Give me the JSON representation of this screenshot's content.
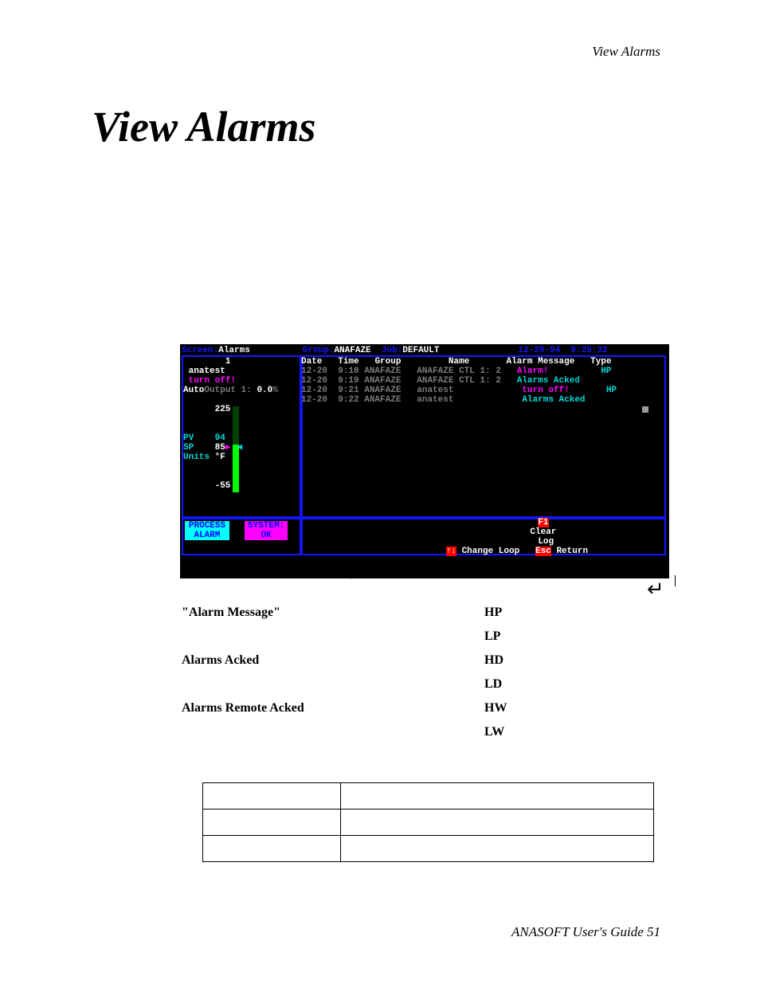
{
  "doc": {
    "running_head": "View Alarms",
    "title": "View Alarms",
    "footer": "ANASOFT User's Guide  51"
  },
  "arrows": {
    "down": "↓",
    "left": "↵"
  },
  "term": {
    "header": {
      "screen_label": "Screen:",
      "screen_val": "Alarms",
      "group_label": "Group:",
      "group_val": "ANAFAZE",
      "job_label": "Job:",
      "job_val": "DEFAULT",
      "date": "12-20-94",
      "time": "9:25:32"
    },
    "left_panel": {
      "index": "1",
      "name": "anatest",
      "warn": "turn off!",
      "auto_label": "Auto",
      "output_label": "Output 1:",
      "output_val": "0.0",
      "output_unit": "%",
      "hi": "225",
      "pv_label": "PV",
      "pv_val": "94",
      "sp_label": "SP",
      "sp_val": "85",
      "units_label": "Units",
      "units_val": "°F",
      "lo": "-55"
    },
    "right_panel": {
      "cols": {
        "c1": "Date",
        "c2": "Time",
        "c3": "Group",
        "c4": "Name",
        "c5": "Alarm Message",
        "c6": "Type"
      },
      "rows": [
        {
          "date": "12-20",
          "time": "9:18",
          "group": "ANAFAZE",
          "name": "ANAFAZE CTL 1: 2",
          "msg": "Alarm!",
          "type": "HP"
        },
        {
          "date": "12-20",
          "time": "9:19",
          "group": "ANAFAZE",
          "name": "ANAFAZE CTL 1: 2",
          "msg": "Alarms Acked",
          "type": ""
        },
        {
          "date": "12-20",
          "time": "9:21",
          "group": "ANAFAZE",
          "name": "anatest",
          "msg": "turn off!",
          "type": "HP"
        },
        {
          "date": "12-20",
          "time": "9:22",
          "group": "ANAFAZE",
          "name": "anatest",
          "msg": "Alarms Acked",
          "type": ""
        }
      ]
    },
    "status": {
      "process_l1": "PROCESS",
      "process_l2": "ALARM",
      "system_l1": "SYSTEM:",
      "system_l2": "OK",
      "f1_key": "F1",
      "f1_l1": "Clear",
      "f1_l2": "Log",
      "arrows_key": "↑↓",
      "arrows_label": "Change Loop",
      "esc_key": "Esc",
      "esc_label": "Return"
    }
  },
  "legend": {
    "left": [
      "\"Alarm Message\"",
      "Alarms Acked",
      "Alarms Remote Acked"
    ],
    "right": [
      "HP",
      "LP",
      "HD",
      "LD",
      "HW",
      "LW"
    ]
  },
  "table_rows": 3
}
